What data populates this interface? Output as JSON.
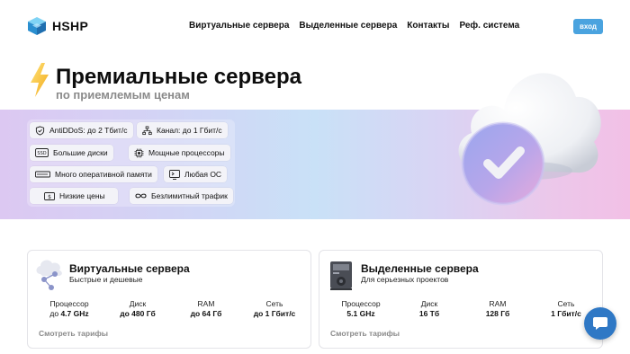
{
  "header": {
    "logo_text": "HSHP",
    "nav": [
      {
        "label": "Виртуальные сервера"
      },
      {
        "label": "Выделенные сервера"
      },
      {
        "label": "Контакты"
      },
      {
        "label": "Реф. система"
      }
    ],
    "login_label": "вход"
  },
  "hero": {
    "title": "Премиальные сервера",
    "subtitle": "по приемлемым ценам",
    "features": [
      {
        "label": "AntiDDoS: до 2 Тбит/с",
        "icon": "shield-icon"
      },
      {
        "label": "Канал: до 1 Гбит/с",
        "icon": "network-icon"
      },
      {
        "label": "Большие диски",
        "icon": "ssd-icon"
      },
      {
        "label": "Мощные процессоры",
        "icon": "cpu-icon"
      },
      {
        "label": "Много оперативной памяти",
        "icon": "ram-icon"
      },
      {
        "label": "Любая ОС",
        "icon": "os-icon"
      },
      {
        "label": "Низкие цены",
        "icon": "money-icon"
      },
      {
        "label": "Безлимитный трафик",
        "icon": "infinity-icon"
      }
    ]
  },
  "cards": [
    {
      "title": "Виртуальные сервера",
      "subtitle": "Быстрые и дешевые",
      "icon": "cloud-share-icon",
      "specs": [
        {
          "label": "Процессор",
          "value": "до 4.7 GHz",
          "prefix": "до ",
          "strong": "4.7 GHz"
        },
        {
          "label": "Диск",
          "value": "до 480 Гб"
        },
        {
          "label": "RAM",
          "value": "до 64 Гб"
        },
        {
          "label": "Сеть",
          "value": "до 1 Гбит/с"
        }
      ],
      "link": "Смотреть тарифы"
    },
    {
      "title": "Выделенные сервера",
      "subtitle": "Для серьезных проектов",
      "icon": "server-tower-icon",
      "specs": [
        {
          "label": "Процессор",
          "value": "5.1 GHz"
        },
        {
          "label": "Диск",
          "value": "16 Тб"
        },
        {
          "label": "RAM",
          "value": "128 Гб"
        },
        {
          "label": "Сеть",
          "value": "1 Гбит/с"
        }
      ],
      "link": "Смотреть тарифы"
    }
  ],
  "colors": {
    "accent": "#4aa3df",
    "chat": "#2f78c5"
  }
}
